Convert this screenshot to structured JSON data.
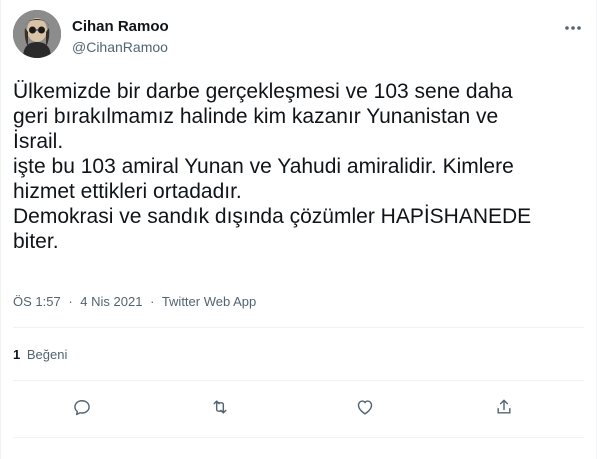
{
  "user": {
    "display_name": "Cihan Ramoo",
    "handle": "@CihanRamoo",
    "avatar_icon": "user-avatar"
  },
  "tweet": {
    "lines": [
      "Ülkemizde bir darbe gerçekleşmesi ve 103 sene daha",
      "geri bırakılmamız halinde kim kazanır Yunanistan ve",
      "İsrail.",
      "işte bu 103 amiral Yunan ve Yahudi amiralidir. Kimlere",
      "hizmet ettikleri ortadadır.",
      "Demokrasi ve sandık dışında çözümler HAPİSHANEDE",
      "biter."
    ]
  },
  "meta": {
    "time": "ÖS 1:57",
    "separator": "·",
    "date": "4 Nis 2021",
    "source": "Twitter Web App"
  },
  "stats": {
    "likes_count": "1",
    "likes_label": "Beğeni"
  },
  "actions": {
    "reply_icon": "reply-icon",
    "retweet_icon": "retweet-icon",
    "like_icon": "like-icon",
    "share_icon": "share-icon"
  },
  "colors": {
    "text": "#0f1419",
    "secondary": "#536471",
    "divider": "#eff3f4"
  }
}
